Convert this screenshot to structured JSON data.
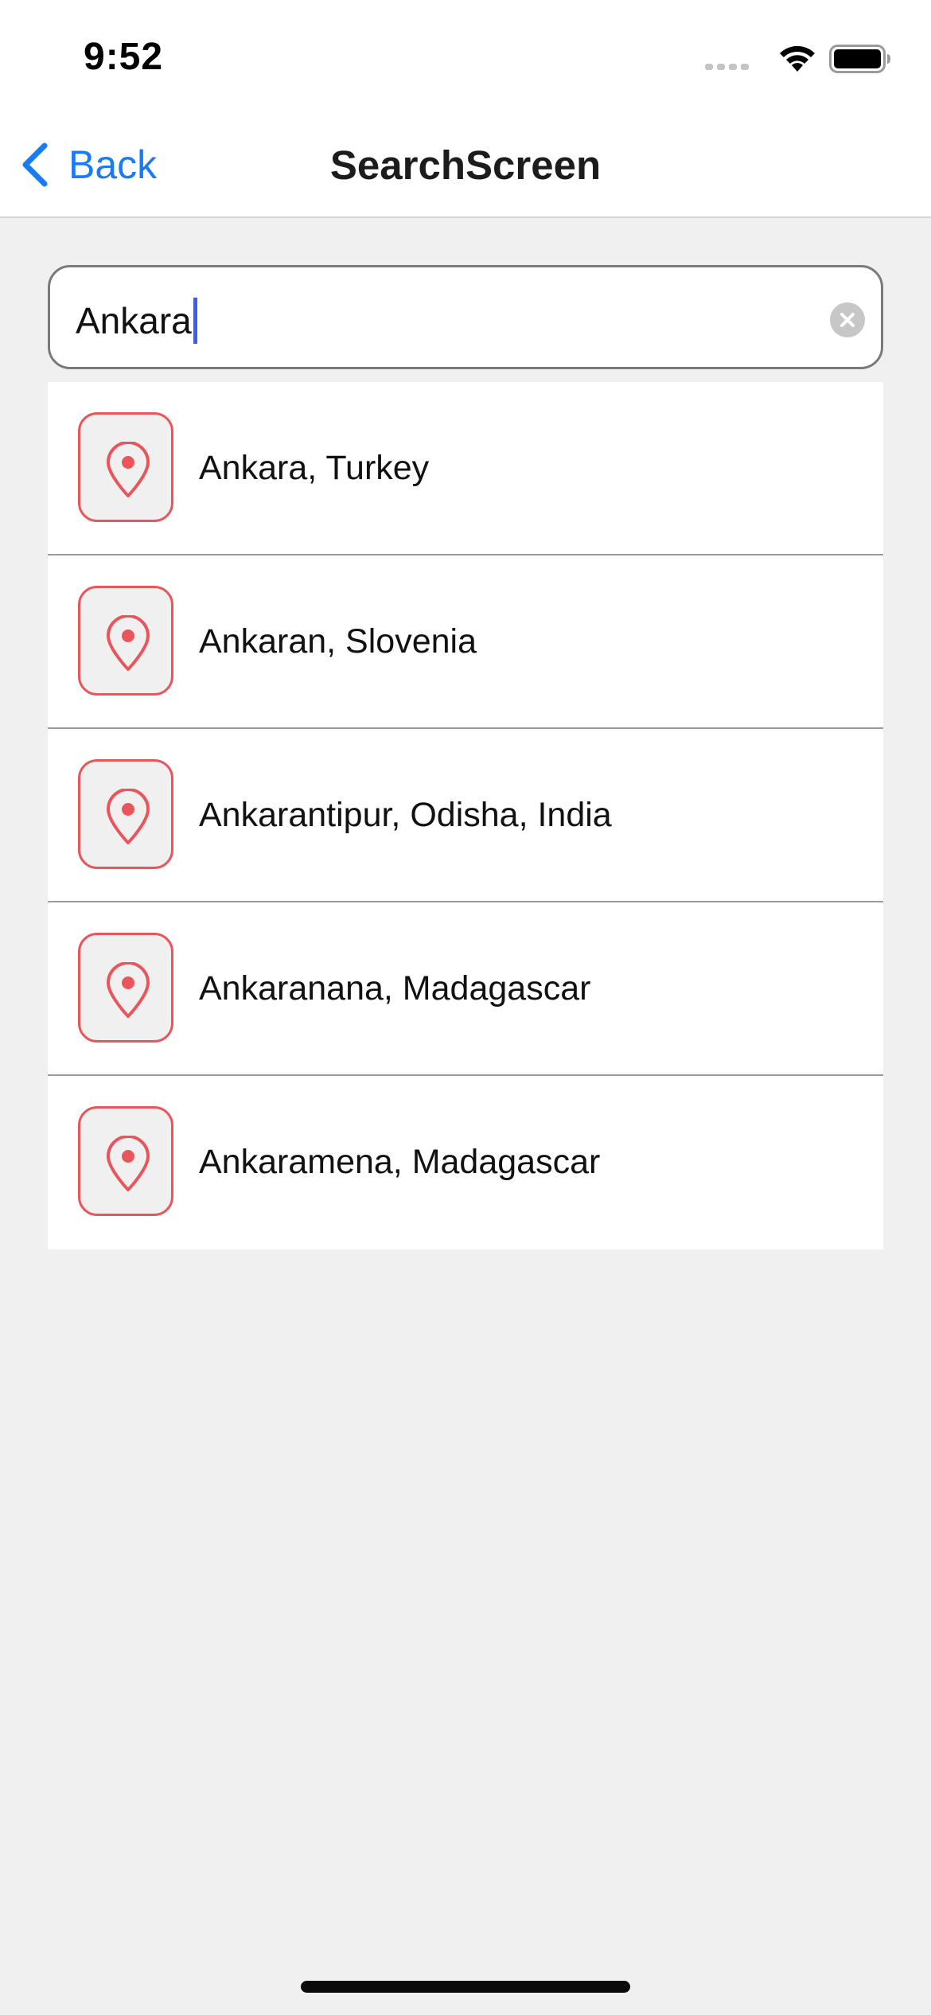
{
  "status_bar": {
    "time": "9:52"
  },
  "header": {
    "back_label": "Back",
    "title": "SearchScreen"
  },
  "search": {
    "value": "Ankara"
  },
  "results": [
    {
      "label": "Ankara, Turkey"
    },
    {
      "label": "Ankaran, Slovenia"
    },
    {
      "label": "Ankarantipur, Odisha, India"
    },
    {
      "label": "Ankaranana, Madagascar"
    },
    {
      "label": "Ankaramena, Madagascar"
    }
  ],
  "icons": {
    "back": "chevron-left-icon",
    "clear": "clear-icon",
    "result": "map-pin-icon",
    "signal": "cellular-signal-icon",
    "wifi": "wifi-icon",
    "battery": "battery-icon"
  },
  "colors": {
    "accent": "#1a7cf5",
    "pin": "#e8565b",
    "caret": "#3d5bf0",
    "background": "#f0f0f0"
  }
}
